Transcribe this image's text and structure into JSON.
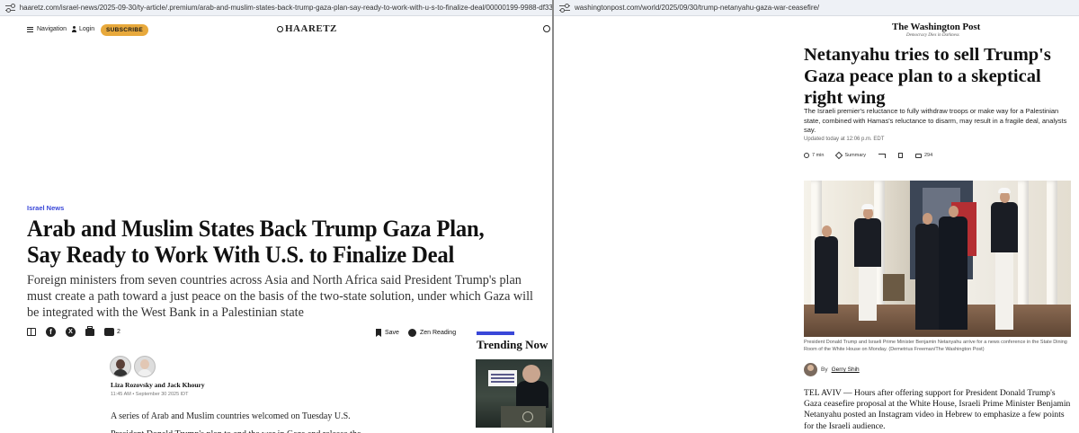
{
  "left": {
    "url": "haaretz.com/israel-news/2025-09-30/ty-article/.premium/arab-and-muslim-states-back-trump-gaza-plan-say-ready-to-work-with-u-s-to-finalize-deal/00000199-9988-df33-a5dd-9dff60a10000",
    "nav_label": "Navigation",
    "login_label": "Login",
    "subscribe_label": "SUBSCRIBE",
    "logo": "HAARETZ",
    "category": "Israel News",
    "title": "Arab and Muslim States Back Trump Gaza Plan, Say Ready to Work With U.S. to Finalize Deal",
    "subtitle": "Foreign ministers from seven countries across Asia and North Africa said President Trump's plan must create a path toward a just peace on the basis of the two-state solution, under which Gaza will be integrated with the West Bank in a Palestinian state",
    "comments_count": "2",
    "save_label": "Save",
    "zen_label": "Zen Reading",
    "authors": "Liza Rozovsky and Jack Khoury",
    "date": "11:45 AM • September 30 2025 IDT",
    "body": "A series of Arab and Muslim countries welcomed on Tuesday U.S. President Donald Trump's plan to end the war in Gaza and release the",
    "trending_label": "Trending Now",
    "accent_color": "#3947d8",
    "subscribe_color": "#e8a93c"
  },
  "right": {
    "url": "washingtonpost.com/world/2025/09/30/trump-netanyahu-gaza-war-ceasefire/",
    "logo": "The Washington Post",
    "tagline": "Democracy Dies in Darkness",
    "title": "Netanyahu tries to sell Trump's Gaza peace plan to a skeptical right wing",
    "dek": "The Israeli premier's reluctance to fully withdraw troops or make way for a Palestinian state, combined with Hamas's reluctance to disarm, may result in a fragile deal, analysts say.",
    "updated": "Updated today at 12:06 p.m. EDT",
    "read_time": "7 min",
    "summary_label": "Summary",
    "comments_count": "294",
    "caption": "President Donald Trump and Israeli Prime Minister Benjamin Netanyahu arrive for a news conference in the State Dining Room of the White House on Monday. (Demetrius Freeman/The Washington Post)",
    "byline_prefix": "By",
    "byline_name": "Gerry Shih",
    "body": "TEL AVIV — Hours after offering support for President Donald Trump's Gaza ceasefire proposal at the White House, Israeli Prime Minister Benjamin Netanyahu posted an Instagram video in Hebrew to emphasize a few points for the Israeli audience."
  }
}
